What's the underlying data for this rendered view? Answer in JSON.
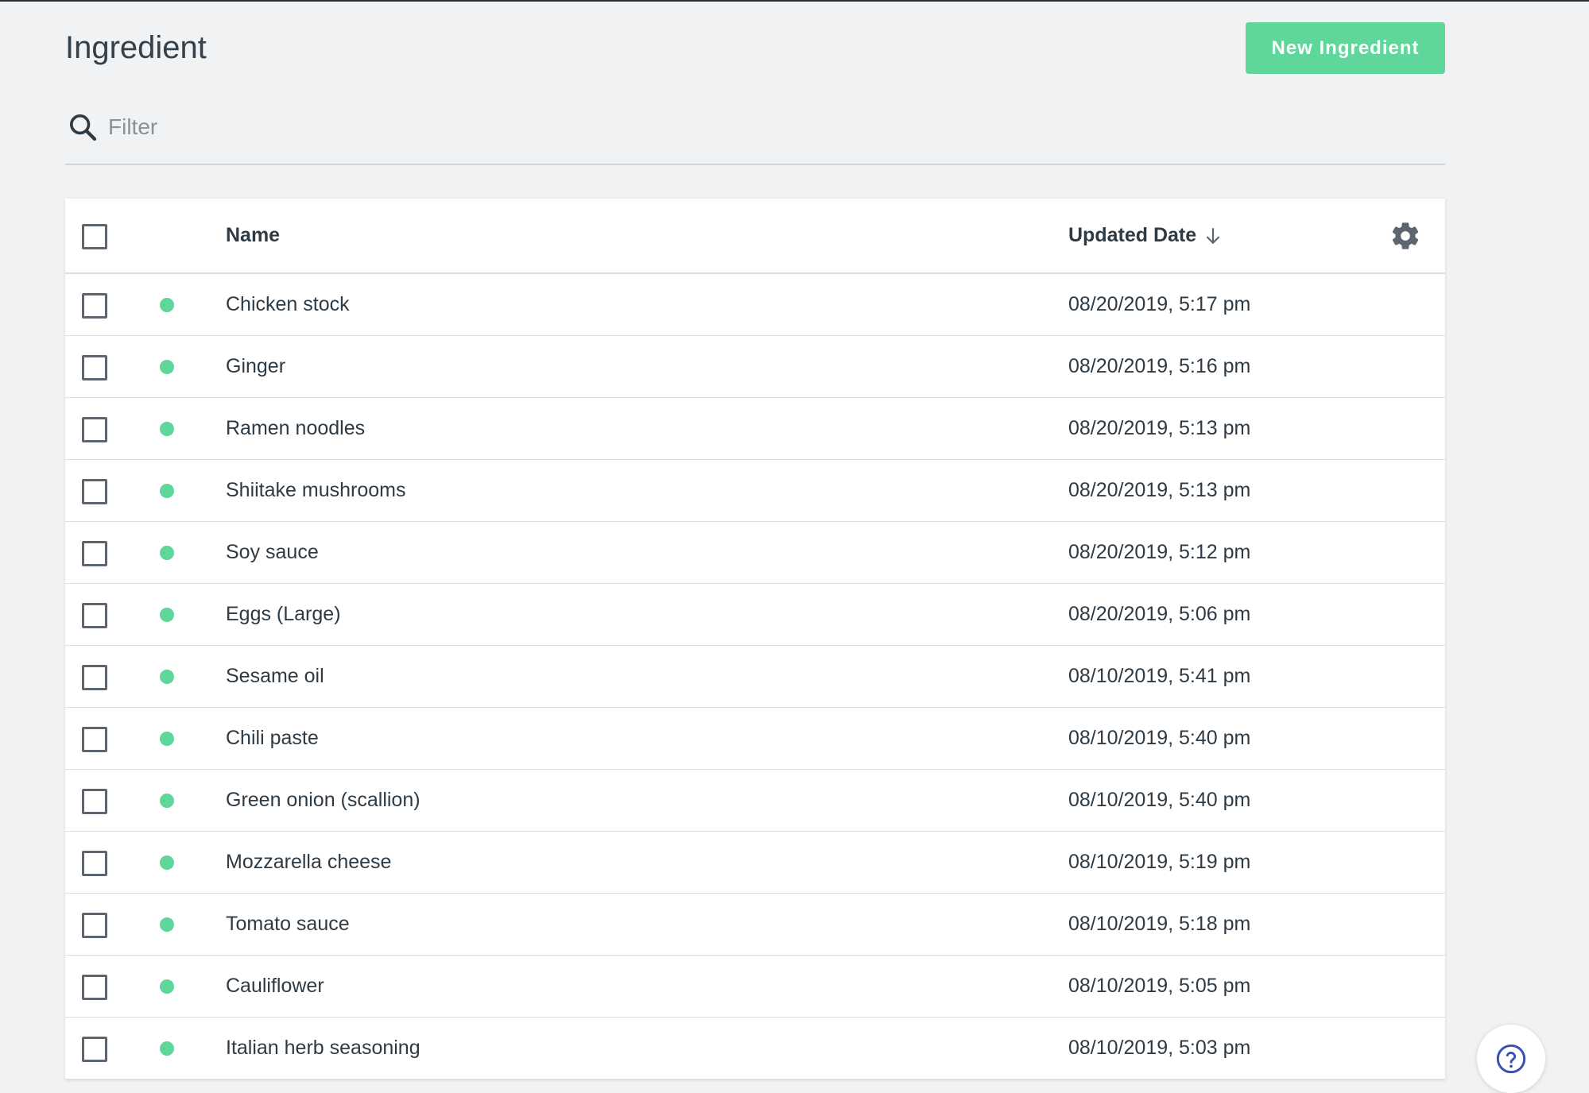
{
  "header": {
    "title": "Ingredient",
    "new_button_label": "New Ingredient"
  },
  "filter": {
    "placeholder": "Filter",
    "value": ""
  },
  "table": {
    "columns": {
      "name": "Name",
      "updated_date": "Updated Date",
      "sort_direction": "descending"
    },
    "status_color": "#5fd69a",
    "accent_color": "#5fd69a",
    "rows": [
      {
        "name": "Chicken stock",
        "updated": "08/20/2019, 5:17 pm"
      },
      {
        "name": "Ginger",
        "updated": "08/20/2019, 5:16 pm"
      },
      {
        "name": "Ramen noodles",
        "updated": "08/20/2019, 5:13 pm"
      },
      {
        "name": "Shiitake mushrooms",
        "updated": "08/20/2019, 5:13 pm"
      },
      {
        "name": "Soy sauce",
        "updated": "08/20/2019, 5:12 pm"
      },
      {
        "name": "Eggs (Large)",
        "updated": "08/20/2019, 5:06 pm"
      },
      {
        "name": "Sesame oil",
        "updated": "08/10/2019, 5:41 pm"
      },
      {
        "name": "Chili paste",
        "updated": "08/10/2019, 5:40 pm"
      },
      {
        "name": "Green onion (scallion)",
        "updated": "08/10/2019, 5:40 pm"
      },
      {
        "name": "Mozzarella cheese",
        "updated": "08/10/2019, 5:19 pm"
      },
      {
        "name": "Tomato sauce",
        "updated": "08/10/2019, 5:18 pm"
      },
      {
        "name": "Cauliflower",
        "updated": "08/10/2019, 5:05 pm"
      },
      {
        "name": "Italian herb seasoning",
        "updated": "08/10/2019, 5:03 pm"
      }
    ]
  },
  "icons": {
    "search": "search-icon",
    "sort": "arrow-down-icon",
    "settings": "gear-icon",
    "help": "question-circle-icon"
  }
}
